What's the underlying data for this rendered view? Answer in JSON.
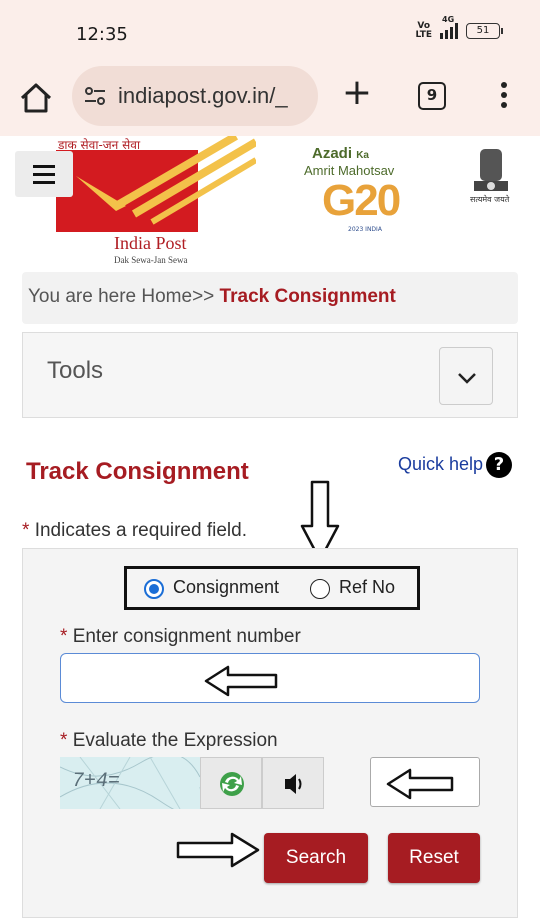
{
  "status_bar": {
    "time": "12:35",
    "volte": "Vo LTE",
    "network": "4G",
    "battery": "51"
  },
  "browser": {
    "url": "indiapost.gov.in/_",
    "tab_count": "9",
    "icons": [
      "home-icon",
      "site-settings-icon",
      "new-tab-icon",
      "tab-switcher-icon",
      "overflow-menu-icon"
    ]
  },
  "header": {
    "tagline_hindi": "डाक सेवा-जन सेवा",
    "brand_name": "India Post",
    "brand_sub": "Dak Sewa-Jan Sewa",
    "azadi": "Azadi",
    "azadi_ka": "Ka",
    "amrit": "Amrit Mahotsav",
    "g20": "G20",
    "g20_small": "2023 INDIA",
    "emblem_text": "सत्यमेव जयते",
    "brand_color": "#d31b20"
  },
  "breadcrumb": {
    "prefix": "You are here Home>> ",
    "current": "Track Consignment"
  },
  "tools": {
    "label": "Tools"
  },
  "track": {
    "title": "Track Consignment",
    "quick_help": "Quick help",
    "help_icon": "?",
    "required_note": "Indicates a required field.",
    "asterisk": "*",
    "radio_options": [
      {
        "label": "Consignment",
        "checked": true
      },
      {
        "label": "Ref No",
        "checked": false
      }
    ],
    "consignment_label": "Enter consignment number",
    "consignment_value": "",
    "captcha_label": "Evaluate the Expression",
    "captcha_expression": "7+4=",
    "captcha_answer": "",
    "search_label": "Search",
    "reset_label": "Reset",
    "accent_color": "#a61c22"
  }
}
